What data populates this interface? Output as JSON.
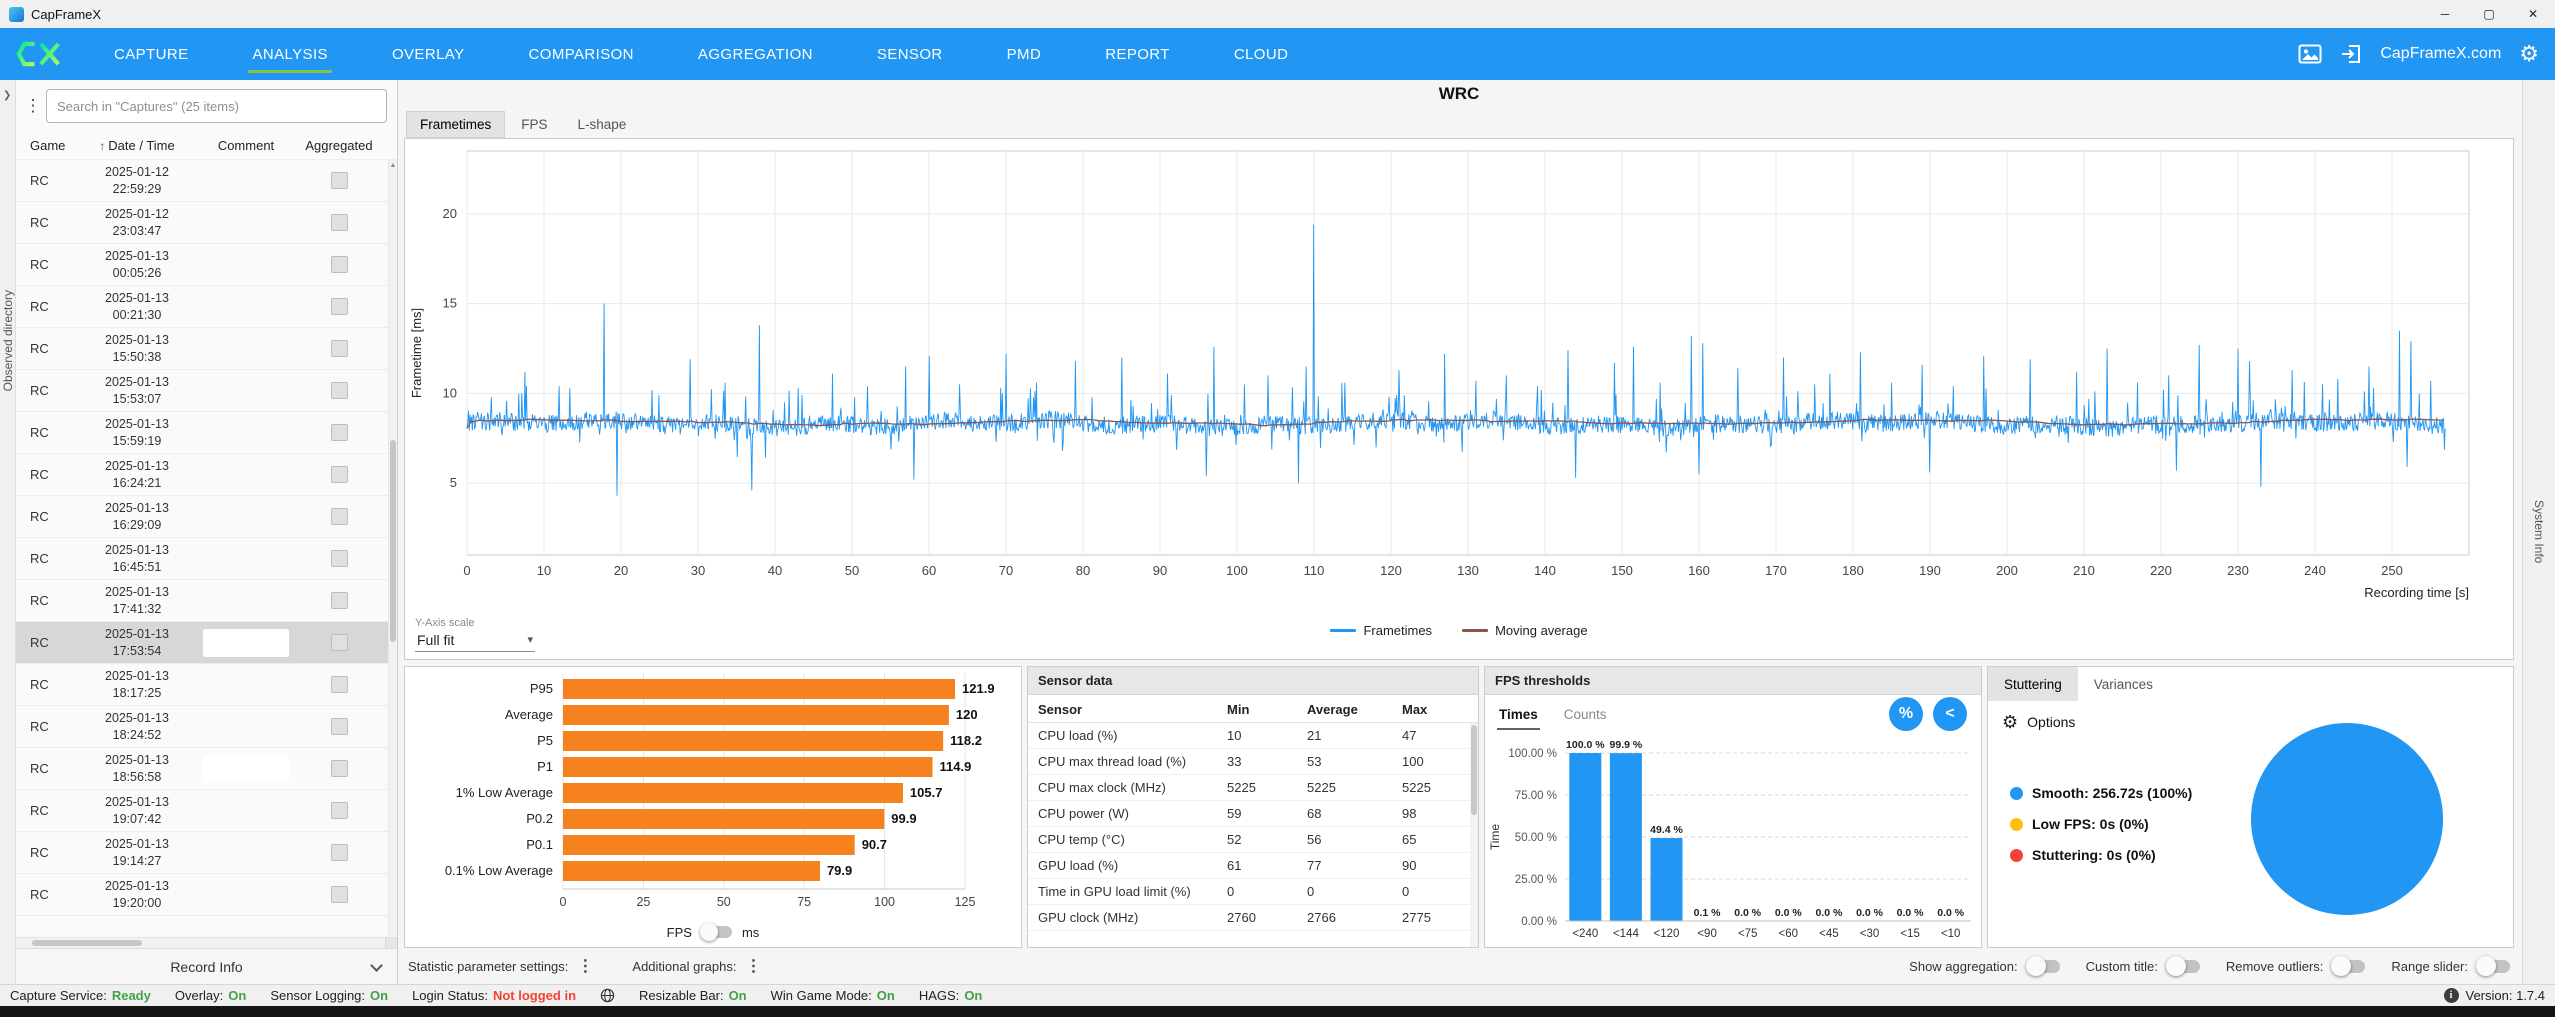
{
  "window": {
    "title": "CapFrameX",
    "controls": {
      "minimize": "─",
      "maximize": "▢",
      "close": "✕"
    }
  },
  "navbar": {
    "tabs": [
      "CAPTURE",
      "ANALYSIS",
      "OVERLAY",
      "COMPARISON",
      "AGGREGATION",
      "SENSOR",
      "PMD",
      "REPORT",
      "CLOUD"
    ],
    "active": "ANALYSIS",
    "site": "CapFrameX.com",
    "accent_underline": "#8bc34a"
  },
  "strips": {
    "left": "Observed directory",
    "right": "System Info"
  },
  "sidebar": {
    "search_placeholder": "Search in \"Captures\" (25 items)",
    "columns": [
      "Game",
      "Date / Time",
      "Comment",
      "Aggregated"
    ],
    "sort_icon": "↑",
    "records": [
      {
        "game": "RC",
        "date": "2025-01-12",
        "time": "22:59:29"
      },
      {
        "game": "RC",
        "date": "2025-01-12",
        "time": "23:03:47"
      },
      {
        "game": "RC",
        "date": "2025-01-13",
        "time": "00:05:26"
      },
      {
        "game": "RC",
        "date": "2025-01-13",
        "time": "00:21:30"
      },
      {
        "game": "RC",
        "date": "2025-01-13",
        "time": "15:50:38"
      },
      {
        "game": "RC",
        "date": "2025-01-13",
        "time": "15:53:07"
      },
      {
        "game": "RC",
        "date": "2025-01-13",
        "time": "15:59:19"
      },
      {
        "game": "RC",
        "date": "2025-01-13",
        "time": "16:24:21"
      },
      {
        "game": "RC",
        "date": "2025-01-13",
        "time": "16:29:09"
      },
      {
        "game": "RC",
        "date": "2025-01-13",
        "time": "16:45:51"
      },
      {
        "game": "RC",
        "date": "2025-01-13",
        "time": "17:41:32"
      },
      {
        "game": "RC",
        "date": "2025-01-13",
        "time": "17:53:54",
        "selected": true,
        "comment_box": true
      },
      {
        "game": "RC",
        "date": "2025-01-13",
        "time": "18:17:25"
      },
      {
        "game": "RC",
        "date": "2025-01-13",
        "time": "18:24:52"
      },
      {
        "game": "RC",
        "date": "2025-01-13",
        "time": "18:56:58",
        "comment_box": true
      },
      {
        "game": "RC",
        "date": "2025-01-13",
        "time": "19:07:42"
      },
      {
        "game": "RC",
        "date": "2025-01-13",
        "time": "19:14:27"
      },
      {
        "game": "RC",
        "date": "2025-01-13",
        "time": "19:20:00"
      }
    ],
    "footer": "Record Info"
  },
  "main": {
    "title": "WRC",
    "tabs": [
      "Frametimes",
      "FPS",
      "L-shape"
    ],
    "active_tab": "Frametimes",
    "yaxis_scale_label": "Y-Axis scale",
    "yaxis_scale_value": "Full fit",
    "legend": [
      {
        "label": "Frametimes",
        "color": "#2196f3"
      },
      {
        "label": "Moving average",
        "color": "#8d564a"
      }
    ]
  },
  "chart_data": [
    {
      "id": "frametimes",
      "type": "line",
      "title": "WRC",
      "xlabel": "Recording time [s]",
      "ylabel": "Frametime [ms]",
      "xlim": [
        0,
        260
      ],
      "ylim": [
        1,
        23.5
      ],
      "xticks": [
        0,
        10,
        20,
        30,
        40,
        50,
        60,
        70,
        80,
        90,
        100,
        110,
        120,
        130,
        140,
        150,
        160,
        170,
        180,
        190,
        200,
        210,
        220,
        230,
        240,
        250
      ],
      "yticks": [
        5,
        10,
        15,
        20
      ],
      "grid": true,
      "legend_position": "bottom",
      "series": [
        {
          "name": "Frametimes",
          "color": "#2196f3",
          "baseline_ms": 8.3,
          "noise_ms": 0.5,
          "duration_s": 257,
          "points": 2600,
          "seed": 42,
          "spikes_up": [
            [
              3.2,
              9.8
            ],
            [
              7.5,
              11.2
            ],
            [
              12,
              10.4
            ],
            [
              17.8,
              15.0
            ],
            [
              24,
              10.2
            ],
            [
              29,
              11.9
            ],
            [
              33.5,
              10.6
            ],
            [
              38,
              13.8
            ],
            [
              43,
              10.3
            ],
            [
              47.5,
              11.1
            ],
            [
              52,
              10.4
            ],
            [
              57,
              11.5
            ],
            [
              60,
              12.1
            ],
            [
              64,
              10.5
            ],
            [
              70,
              12.2
            ],
            [
              74,
              10.6
            ],
            [
              79,
              11.8
            ],
            [
              85,
              12.0
            ],
            [
              91,
              11.1
            ],
            [
              97,
              12.6
            ],
            [
              101,
              10.5
            ],
            [
              104,
              11.0
            ],
            [
              109,
              11.5
            ],
            [
              110,
              19.4
            ],
            [
              114,
              10.6
            ],
            [
              121,
              11.3
            ],
            [
              127,
              12.2
            ],
            [
              131,
              10.7
            ],
            [
              135,
              11.0
            ],
            [
              139,
              10.4
            ],
            [
              143,
              12.4
            ],
            [
              149,
              11.7
            ],
            [
              151.5,
              12.6
            ],
            [
              155,
              10.6
            ],
            [
              159,
              13.2
            ],
            [
              160.5,
              12.8
            ],
            [
              165,
              11.4
            ],
            [
              171,
              12.0
            ],
            [
              175,
              10.5
            ],
            [
              177,
              11.1
            ],
            [
              181,
              12.3
            ],
            [
              185,
              10.6
            ],
            [
              189,
              11.6
            ],
            [
              193,
              10.4
            ],
            [
              197,
              12.1
            ],
            [
              203,
              11.9
            ],
            [
              209,
              11.2
            ],
            [
              213,
              12.5
            ],
            [
              217,
              10.6
            ],
            [
              221,
              11.0
            ],
            [
              225,
              12.7
            ],
            [
              230,
              12.5
            ],
            [
              231.5,
              11.8
            ],
            [
              237,
              11.3
            ],
            [
              241,
              10.5
            ],
            [
              243,
              10.8
            ],
            [
              247,
              11.5
            ],
            [
              251,
              13.5
            ],
            [
              252.5,
              12.9
            ],
            [
              255,
              10.7
            ]
          ],
          "spikes_down": [
            [
              19.5,
              4.3
            ],
            [
              37,
              4.6
            ],
            [
              58,
              5.2
            ],
            [
              96,
              5.4
            ],
            [
              108,
              5.0
            ],
            [
              144,
              5.3
            ],
            [
              160,
              5.5
            ],
            [
              190,
              5.6
            ],
            [
              222,
              5.7
            ],
            [
              233,
              4.8
            ],
            [
              252,
              5.9
            ]
          ]
        },
        {
          "name": "Moving average",
          "color": "#8d564a",
          "window_points": 120
        }
      ]
    },
    {
      "id": "fps_percentiles",
      "type": "bar",
      "orientation": "horizontal",
      "categories": [
        "P95",
        "Average",
        "P5",
        "P1",
        "1% Low Average",
        "P0.2",
        "P0.1",
        "0.1% Low Average"
      ],
      "values": [
        121.9,
        120,
        118.2,
        114.9,
        105.7,
        99.9,
        90.7,
        79.9
      ],
      "xlim": [
        0,
        125
      ],
      "xticks": [
        0,
        25,
        50,
        75,
        100,
        125
      ],
      "bar_color": "#f5821f",
      "unit_options": [
        "FPS",
        "ms"
      ],
      "unit_selected": "FPS"
    },
    {
      "id": "fps_thresholds",
      "type": "bar",
      "categories": [
        "<240",
        "<144",
        "<120",
        "<90",
        "<75",
        "<60",
        "<45",
        "<30",
        "<15",
        "<10"
      ],
      "values": [
        100.0,
        99.9,
        49.4,
        0.1,
        0.0,
        0.0,
        0.0,
        0.0,
        0.0,
        0.0
      ],
      "value_labels": [
        "100.0 %",
        "99.9 %",
        "49.4 %",
        "0.1 %",
        "0.0 %",
        "0.0 %",
        "0.0 %",
        "0.0 %",
        "0.0 %",
        "0.0 %"
      ],
      "ylabel": "Time",
      "ylim": [
        0,
        100
      ],
      "yticks_labels": [
        "0.00 %",
        "25.00 %",
        "50.00 %",
        "75.00 %",
        "100.00 %"
      ],
      "bar_color": "#2196f3"
    },
    {
      "id": "stuttering_pie",
      "type": "pie",
      "slices": [
        {
          "label": "Smooth:  256.72s (100%)",
          "value": 100,
          "color": "#2196f3"
        },
        {
          "label": "Low FPS:  0s (0%)",
          "value": 0,
          "color": "#ffc107"
        },
        {
          "label": "Stuttering:  0s (0%)",
          "value": 0,
          "color": "#f44336"
        }
      ]
    }
  ],
  "sensor_panel": {
    "title": "Sensor data",
    "columns": [
      "Sensor",
      "Min",
      "Average",
      "Max"
    ],
    "rows": [
      [
        "CPU load (%)",
        "10",
        "21",
        "47"
      ],
      [
        "CPU max thread load (%)",
        "33",
        "53",
        "100"
      ],
      [
        "CPU max clock (MHz)",
        "5225",
        "5225",
        "5225"
      ],
      [
        "CPU power (W)",
        "59",
        "68",
        "98"
      ],
      [
        "CPU temp (°C)",
        "52",
        "56",
        "65"
      ],
      [
        "GPU load (%)",
        "61",
        "77",
        "90"
      ],
      [
        "Time in GPU load limit (%)",
        "0",
        "0",
        "0"
      ],
      [
        "GPU clock (MHz)",
        "2760",
        "2766",
        "2775"
      ]
    ]
  },
  "thresholds_panel": {
    "title": "FPS thresholds",
    "tabs": [
      "Times",
      "Counts"
    ],
    "active_tab": "Times",
    "buttons": [
      "%",
      "<"
    ]
  },
  "stutter_panel": {
    "tabs": [
      "Stuttering",
      "Variances"
    ],
    "active_tab": "Stuttering",
    "options_label": "Options"
  },
  "footer_controls": {
    "stat_settings_label": "Statistic parameter settings:",
    "additional_graphs_label": "Additional graphs:",
    "toggles": [
      "Show aggregation:",
      "Custom title:",
      "Remove outliers:",
      "Range slider:"
    ]
  },
  "statusbar": {
    "items": [
      {
        "label": "Capture Service:",
        "value": "Ready",
        "value_color": "#43a047"
      },
      {
        "label": "Overlay:",
        "value": "On",
        "value_color": "#43a047"
      },
      {
        "label": "Sensor Logging:",
        "value": "On",
        "value_color": "#43a047"
      },
      {
        "label": "Login Status:",
        "value": "Not logged in",
        "value_color": "#f44336"
      },
      {
        "label": "Resizable Bar:",
        "value": "On",
        "value_color": "#43a047"
      },
      {
        "label": "Win Game Mode:",
        "value": "On",
        "value_color": "#43a047"
      },
      {
        "label": "HAGS:",
        "value": "On",
        "value_color": "#43a047"
      }
    ],
    "version_label": "Version: 1.7.4"
  }
}
